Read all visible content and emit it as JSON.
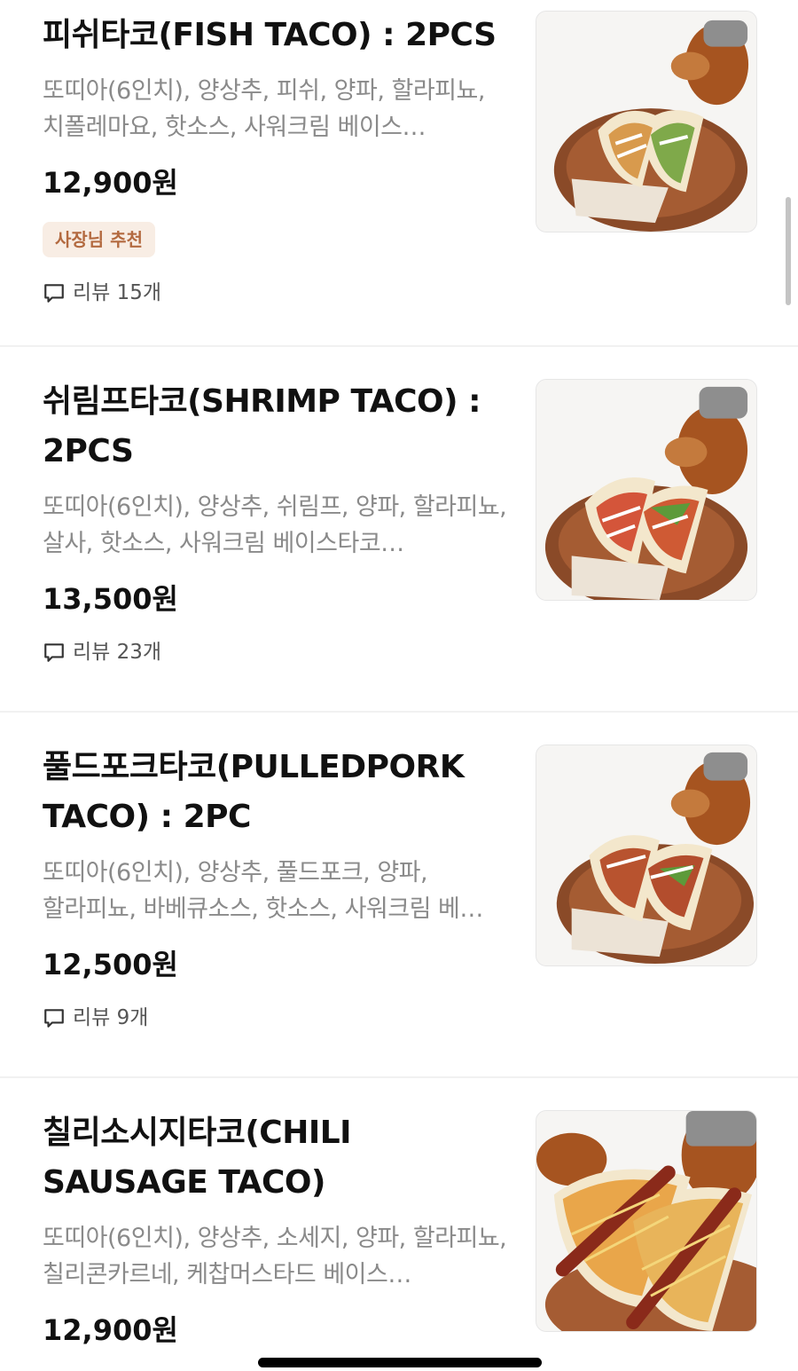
{
  "items": [
    {
      "name": "피쉬타코(FISH TACO) : 2PCS",
      "description": "또띠아(6인치), 양상추, 피쉬, 양파, 할라피뇨, 치폴레마요, 핫소스, 사워크림 베이스…",
      "price": "12,900원",
      "badge": "사장님 추천",
      "review": "리뷰 15개"
    },
    {
      "name": "쉬림프타코(SHRIMP TACO) : 2PCS",
      "description": "또띠아(6인치), 양상추, 쉬림프, 양파, 할라피뇨, 살사, 핫소스, 사워크림 베이스타코…",
      "price": "13,500원",
      "review": "리뷰 23개"
    },
    {
      "name": "풀드포크타코(PULLEDPORK TACO) : 2PC",
      "description": "또띠아(6인치), 양상추, 풀드포크, 양파, 할라피뇨, 바베큐소스, 핫소스, 사워크림 베…",
      "price": "12,500원",
      "review": "리뷰 9개"
    },
    {
      "name": "칠리소시지타코(CHILI SAUSAGE TACO)",
      "description": "또띠아(6인치), 양상추, 소세지, 양파, 할라피뇨, 칠리콘카르네, 케찹머스타드 베이스…",
      "price": "12,900원"
    }
  ],
  "thumbnail_icons": [
    "fish-taco-photo",
    "shrimp-taco-photo",
    "pulledpork-taco-photo",
    "chili-sausage-taco-photo"
  ],
  "colors": {
    "badge_text": "#b36a40",
    "badge_bg": "#f8ede4",
    "description": "#8a8a8a",
    "divider": "#f1f1f1"
  }
}
